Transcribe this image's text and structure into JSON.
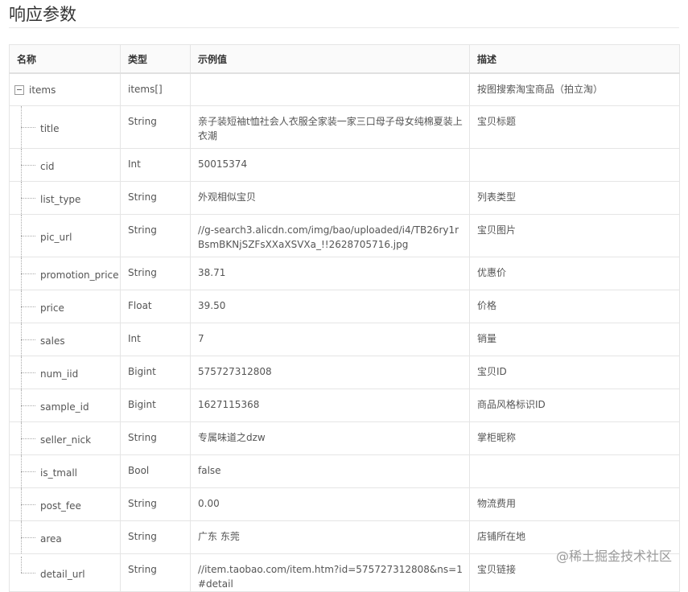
{
  "page": {
    "title": "响应参数"
  },
  "table": {
    "headers": [
      "名称",
      "类型",
      "示例值",
      "描述"
    ],
    "root": {
      "name": "items",
      "type": "items[]",
      "example": "",
      "description": "按图搜索淘宝商品（拍立淘）"
    },
    "rows": [
      {
        "name": "title",
        "type": "String",
        "example": "亲子装短袖t恤社会人衣服全家装一家三口母子母女纯棉夏装上衣潮",
        "description": "宝贝标题"
      },
      {
        "name": "cid",
        "type": "Int",
        "example": "50015374",
        "description": ""
      },
      {
        "name": "list_type",
        "type": "String",
        "example": "外观相似宝贝",
        "description": "列表类型"
      },
      {
        "name": "pic_url",
        "type": "String",
        "example": "//g-search3.alicdn.com/img/bao/uploaded/i4/TB26ry1rBsmBKNjSZFsXXaXSVXa_!!2628705716.jpg",
        "description": "宝贝图片"
      },
      {
        "name": "promotion_price",
        "type": "String",
        "example": "38.71",
        "description": "优惠价"
      },
      {
        "name": "price",
        "type": "Float",
        "example": "39.50",
        "description": "价格"
      },
      {
        "name": "sales",
        "type": "Int",
        "example": "7",
        "description": "销量"
      },
      {
        "name": "num_iid",
        "type": "Bigint",
        "example": "575727312808",
        "description": "宝贝ID"
      },
      {
        "name": "sample_id",
        "type": "Bigint",
        "example": "1627115368",
        "description": "商品风格标识ID"
      },
      {
        "name": "seller_nick",
        "type": "String",
        "example": "专属味道之dzw",
        "description": "掌柜昵称"
      },
      {
        "name": "is_tmall",
        "type": "Bool",
        "example": "false",
        "description": ""
      },
      {
        "name": "post_fee",
        "type": "String",
        "example": "0.00",
        "description": "物流费用"
      },
      {
        "name": "area",
        "type": "String",
        "example": "广东 东莞",
        "description": "店铺所在地"
      },
      {
        "name": "detail_url",
        "type": "String",
        "example": "//item.taobao.com/item.htm?id=575727312808&ns=1#detail",
        "description": "宝贝链接"
      }
    ]
  },
  "watermark": {
    "text": "@稀土掘金技术社区"
  }
}
